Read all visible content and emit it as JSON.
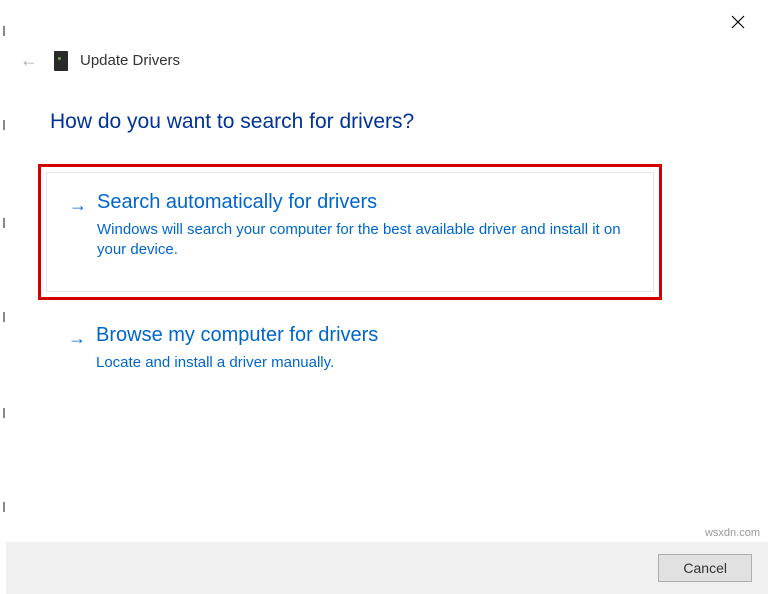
{
  "header": {
    "title": "Update Drivers"
  },
  "question": "How do you want to search for drivers?",
  "options": {
    "auto": {
      "title": "Search automatically for drivers",
      "desc": "Windows will search your computer for the best available driver and install it on your device."
    },
    "browse": {
      "title": "Browse my computer for drivers",
      "desc": "Locate and install a driver manually."
    }
  },
  "footer": {
    "cancel": "Cancel"
  },
  "watermark": "wsxdn.com"
}
